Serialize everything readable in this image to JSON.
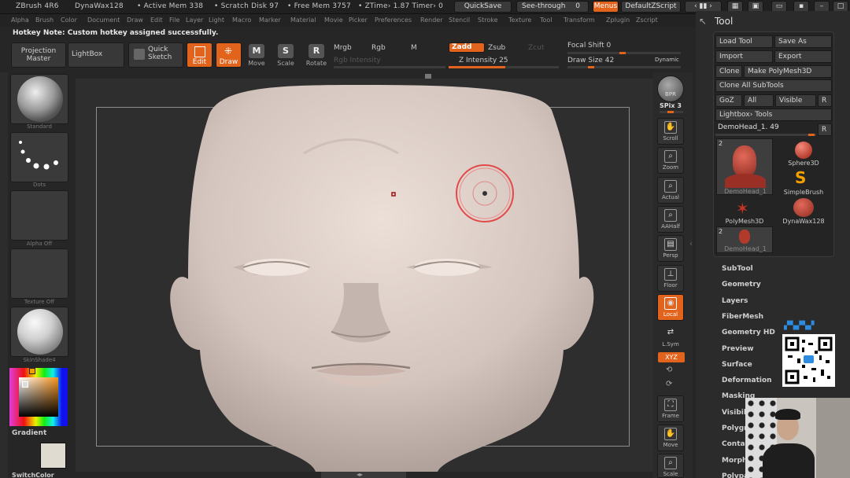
{
  "titlebar": {
    "app": "ZBrush 4R6",
    "doc": "DynaWax128",
    "active_mem": "• Active Mem 338",
    "scratch": "• Scratch Disk 97",
    "free_mem": "• Free Mem 3757",
    "ztime": "• ZTime› 1.87 Timer› 0",
    "quicksave": "QuickSave",
    "seethrough": "See-through",
    "seethrough_val": "0",
    "menus": "Menus",
    "script": "DefaultZScript"
  },
  "menubar": [
    "Alpha",
    "Brush",
    "Color",
    "Document",
    "Draw",
    "Edit",
    "File",
    "Layer",
    "Light",
    "Macro",
    "Marker",
    "Material",
    "Movie",
    "Picker",
    "Preferences",
    "Render",
    "Stencil",
    "Stroke",
    "Texture",
    "Tool",
    "Transform",
    "Zplugin",
    "Zscript"
  ],
  "hotkey_note": "Hotkey Note: Custom hotkey assigned successfully.",
  "shelf": {
    "projection_master": "Projection Master",
    "lightbox": "LightBox",
    "quick_sketch": "Quick Sketch",
    "edit": "Edit",
    "draw": "Draw",
    "move": "Move",
    "scale": "Scale",
    "rotate": "Rotate",
    "mrgb": "Mrgb",
    "rgb": "Rgb",
    "m": "M",
    "rgb_intensity": "Rgb Intensity",
    "zadd": "Zadd",
    "zsub": "Zsub",
    "zcut": "Zcut",
    "z_intensity_label": "Z Intensity",
    "z_intensity": "25",
    "focal_shift_label": "Focal Shift",
    "focal_shift": "0",
    "draw_size_label": "Draw Size",
    "draw_size": "42",
    "dynamic": "Dynamic"
  },
  "left": {
    "brush": "Standard",
    "stroke": "Dots",
    "alpha": "Alpha  Off",
    "texture": "Texture  Off",
    "material": "SkinShade4",
    "gradient": "Gradient",
    "switchcolor": "SwitchColor"
  },
  "right_shelf": {
    "bpr": "BPR",
    "spix": "SPix 3",
    "scroll": "Scroll",
    "zoom": "Zoom",
    "actual": "Actual",
    "aahalf": "AAHalf",
    "persp": "Persp",
    "floor": "Floor",
    "local": "Local",
    "lsym": "L.Sym",
    "xyz": "XYZ",
    "frame": "Frame",
    "move": "Move",
    "scale": "Scale"
  },
  "tool": {
    "title": "Tool",
    "load_tool": "Load Tool",
    "save_as": "Save As",
    "import": "Import",
    "export": "Export",
    "clone": "Clone",
    "make_polymesh": "Make PolyMesh3D",
    "clone_all": "Clone  All  SubTools",
    "goz": "GoZ",
    "all": "All",
    "visible": "Visible",
    "r": "R",
    "lightbox_tools": "Lightbox› Tools",
    "current": "DemoHead_1. 49",
    "thumbs": [
      {
        "label": "DemoHead_1",
        "count": "2"
      },
      {
        "label": "Sphere3D"
      },
      {
        "label": "SimpleBrush"
      },
      {
        "label": "PolyMesh3D"
      },
      {
        "label": "DynaWax128"
      },
      {
        "label": "DemoHead_1",
        "count": "2"
      }
    ],
    "sections": [
      "SubTool",
      "Geometry",
      "Layers",
      "FiberMesh",
      "Geometry HD",
      "Preview",
      "Surface",
      "Deformation",
      "Masking",
      "Visibility",
      "Polygroups",
      "Contact",
      "Morph Target",
      "Polypaint"
    ]
  }
}
